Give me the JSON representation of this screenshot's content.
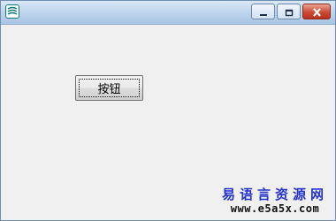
{
  "window": {
    "icon": "easy-language-app-icon",
    "controls": {
      "minimize_icon": "minimize-icon",
      "maximize_icon": "maximize-icon",
      "close_icon": "close-icon"
    }
  },
  "form": {
    "button_label": "按钮"
  },
  "watermark": {
    "title": "易语言资源网",
    "url": "www.e5a5x.com"
  },
  "colors": {
    "titlebar": "#b9d1ea",
    "close_button": "#cc4a33",
    "watermark_title": "#2433c9"
  }
}
